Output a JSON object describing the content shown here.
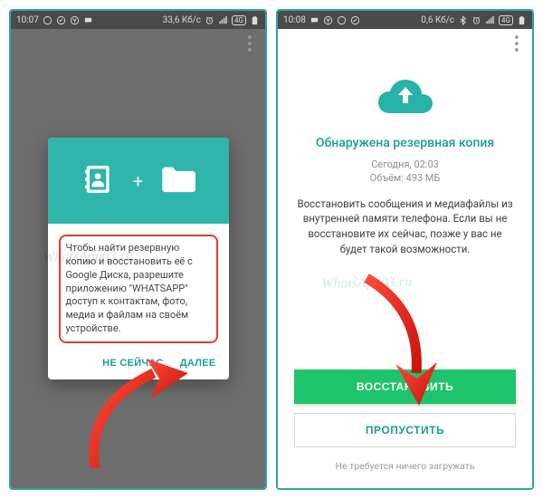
{
  "left": {
    "status": {
      "time": "10:07",
      "speed": "33,6 Кб/с",
      "net_badge": "4G"
    },
    "dialog": {
      "text": "Чтобы найти резервную копию и восстановить её с Google Диска, разрешите приложению \"WHATSAPP\" доступ к контактам, фото, медиа и файлам на своём устройстве.",
      "not_now": "НЕ СЕЙЧАС",
      "next": "ДАЛЕЕ"
    },
    "watermark": "WhatsApp03.ru"
  },
  "right": {
    "status": {
      "time": "10:08",
      "speed": "0,6 Кб/с",
      "net_badge": "4G"
    },
    "headline": "Обнаружена резервная копия",
    "date": "Сегодня, 02:03",
    "size": "Объём: 493 МБ",
    "desc": "Восстановить сообщения и медиафайлы из внутренней памяти телефона. Если вы не восстановите их сейчас, позже у вас не будет такой возможности.",
    "restore": "ВОССТАНОВИТЬ",
    "skip": "ПРОПУСТИТЬ",
    "footer": "Не требуется ничего загружать",
    "watermark": "WhatsApp03.ru"
  }
}
